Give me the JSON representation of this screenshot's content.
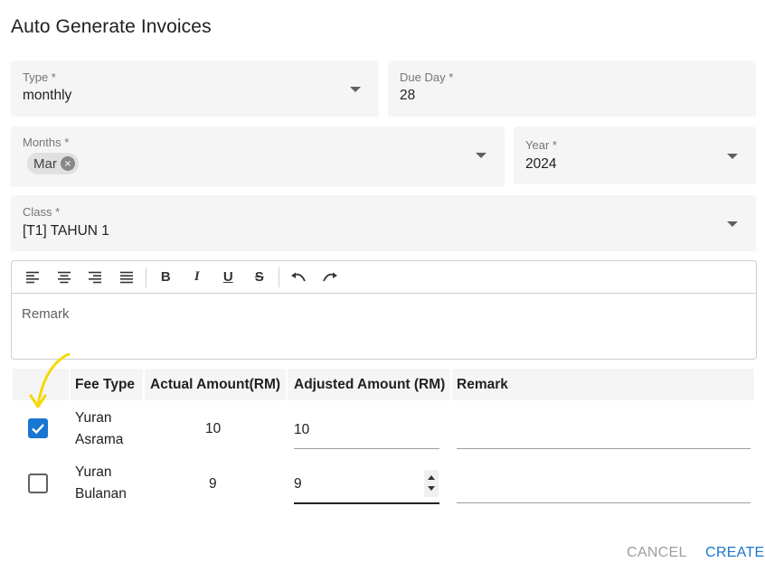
{
  "dialog": {
    "title": "Auto Generate Invoices"
  },
  "form": {
    "type": {
      "label": "Type *",
      "value": "monthly"
    },
    "due_day": {
      "label": "Due Day *",
      "value": "28"
    },
    "months": {
      "label": "Months *",
      "chips": [
        "Mar"
      ]
    },
    "year": {
      "label": "Year *",
      "value": "2024"
    },
    "class": {
      "label": "Class *",
      "value": "[T1] TAHUN 1"
    },
    "remark": {
      "placeholder": "Remark"
    }
  },
  "editor_toolbar": {
    "icons": [
      "align-left-icon",
      "align-center-icon",
      "align-right-icon",
      "align-justify-icon",
      "bold-icon",
      "italic-icon",
      "underline-icon",
      "strikethrough-icon",
      "undo-icon",
      "redo-icon"
    ],
    "bold": "B",
    "italic": "I",
    "underline": "U",
    "strike": "S"
  },
  "fees_table": {
    "columns": [
      "Fee Type",
      "Actual Amount(RM)",
      "Adjusted Amount (RM)",
      "Remark"
    ],
    "rows": [
      {
        "checked": true,
        "fee_line1": "Yuran",
        "fee_line2": "Asrama",
        "actual": "10",
        "adjusted": "10",
        "remark": ""
      },
      {
        "checked": false,
        "fee_line1": "Yuran",
        "fee_line2": "Bulanan",
        "actual": "9",
        "adjusted": "9",
        "remark": ""
      }
    ]
  },
  "actions": {
    "cancel": "CANCEL",
    "create": "CREATE"
  },
  "colors": {
    "primary": "#1976d2",
    "annotation": "#f5d80a",
    "field_bg": "#f5f5f5"
  }
}
